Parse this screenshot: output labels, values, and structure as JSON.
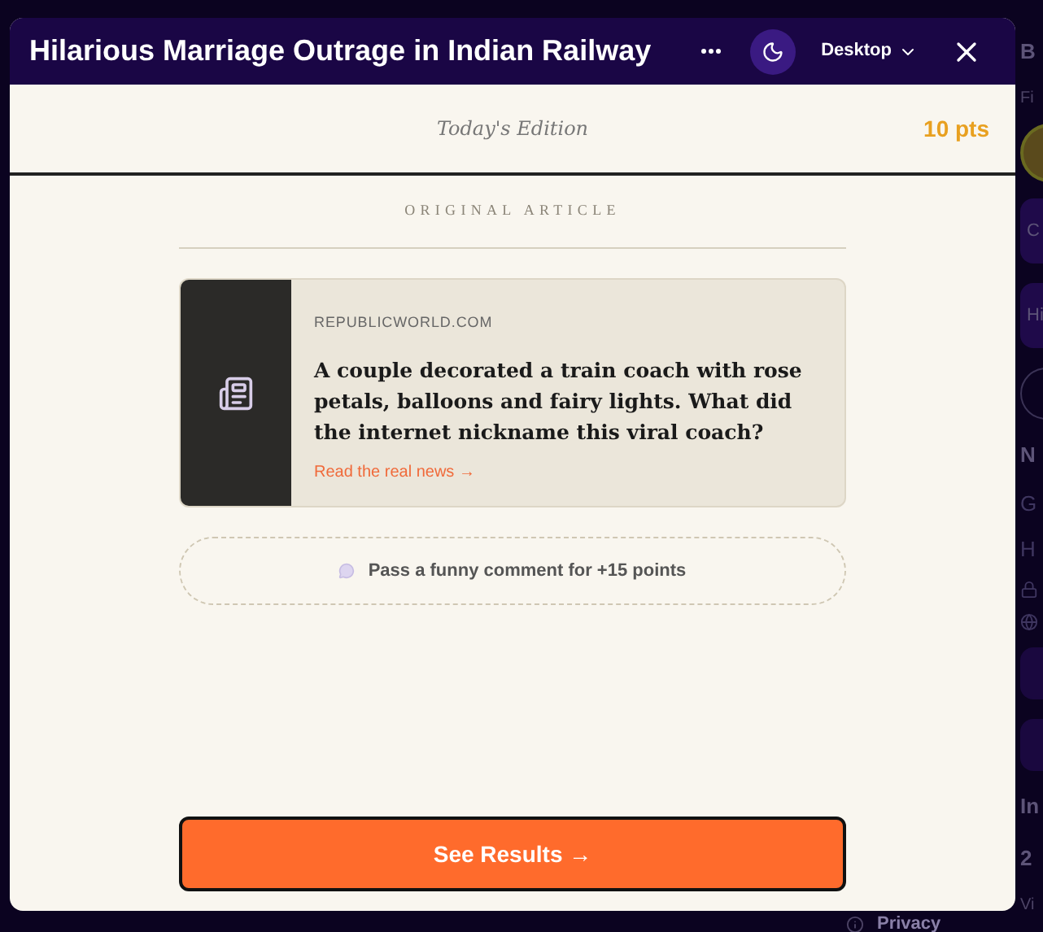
{
  "modal": {
    "title": "Hilarious Marriage Outrage in Indian Railway",
    "view_mode": "Desktop",
    "edition": "Today's Edition",
    "points": "10 pts"
  },
  "article": {
    "section_label": "ORIGINAL ARTICLE",
    "source": "REPUBLICWORLD.COM",
    "question": "A couple decorated a train coach with rose petals, balloons and fairy lights. What did the internet nickname this viral coach?",
    "link": "Read the real news →"
  },
  "comment_prompt": "Pass a funny comment for +15 points",
  "primary_button": "See Results →",
  "background": {
    "items": [
      {
        "kind": "heading",
        "text": "B"
      },
      {
        "kind": "small",
        "text": "Fi"
      },
      {
        "kind": "avatar"
      },
      {
        "kind": "card",
        "text": "C"
      },
      {
        "kind": "card",
        "text": "Hi"
      },
      {
        "kind": "ring"
      },
      {
        "kind": "heading",
        "text": "N"
      },
      {
        "kind": "muted",
        "text": "G"
      },
      {
        "kind": "muted",
        "text": "H"
      },
      {
        "kind": "icon"
      },
      {
        "kind": "globe"
      },
      {
        "kind": "blank"
      },
      {
        "kind": "blank"
      },
      {
        "kind": "heading",
        "text": "In"
      },
      {
        "kind": "heading",
        "text": "2"
      },
      {
        "kind": "small",
        "text": "Vi"
      }
    ],
    "footer_link": "Privacy"
  }
}
